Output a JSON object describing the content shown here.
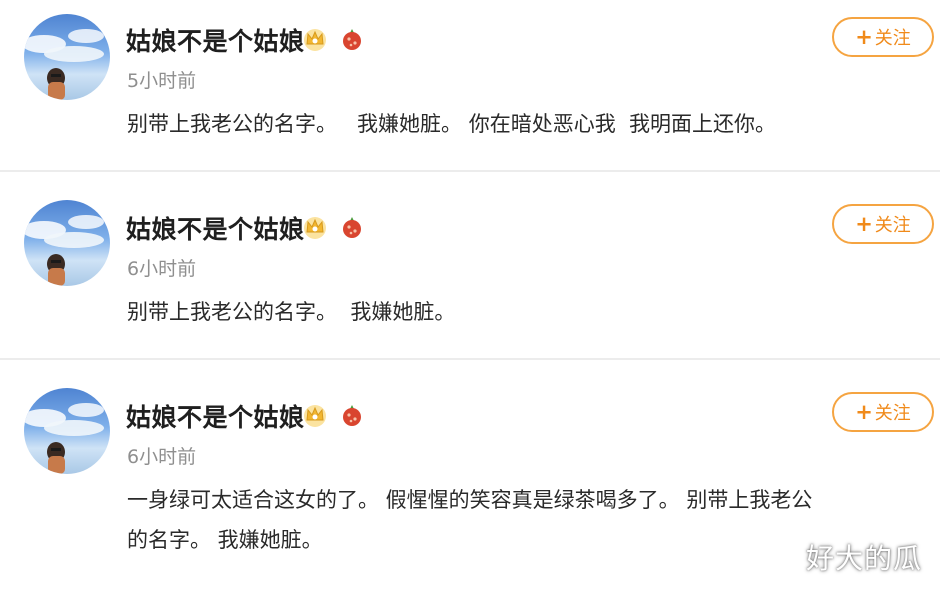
{
  "posts": [
    {
      "username": "姑娘不是个姑娘",
      "time": "5小时前",
      "lines": [
        "别带上我老公的名字。   我嫌她脏。 你在暗处恶心我  我明面上还你。"
      ],
      "follow_label": "关注"
    },
    {
      "username": "姑娘不是个姑娘",
      "time": "6小时前",
      "lines": [
        "别带上我老公的名字。  我嫌她脏。"
      ],
      "follow_label": "关注"
    },
    {
      "username": "姑娘不是个姑娘",
      "time": "6小时前",
      "lines": [
        "一身绿可太适合这女的了。 假惺惺的笑容真是绿茶喝多了。 别带上我老公",
        "的名字。 我嫌她脏。"
      ],
      "follow_label": "关注"
    }
  ],
  "watermark": "好大的瓜",
  "colors": {
    "accent": "#f08a1a",
    "follow_border": "#f5a441",
    "time_text": "#8f8f8f",
    "badge_gold": "#f2b630",
    "badge_red": "#d9452f"
  },
  "icons": [
    "avatar-photo",
    "crown-badge-icon",
    "fruit-badge-icon",
    "plus-icon"
  ]
}
